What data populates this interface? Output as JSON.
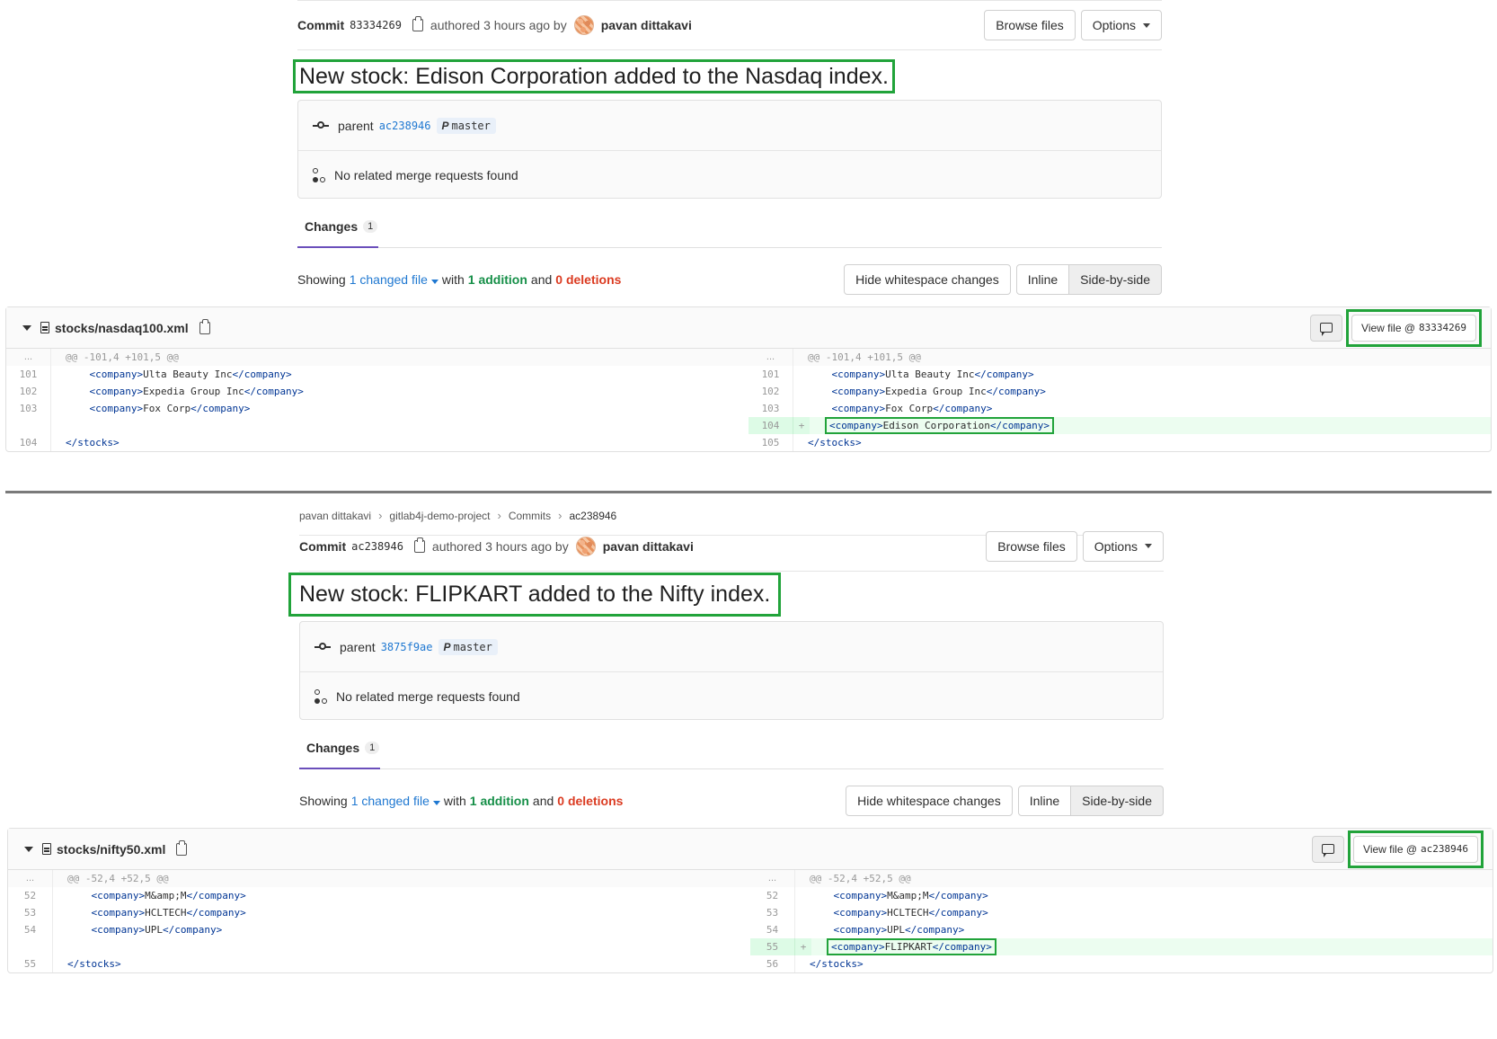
{
  "panel1": {
    "commit_label": "Commit",
    "commit_sha": "83334269",
    "authored_text": "authored 3 hours ago by",
    "author_name": "pavan dittakavi",
    "browse_files_label": "Browse files",
    "options_label": "Options",
    "title": "New stock: Edison Corporation added to the Nasdaq index.",
    "parent_label": "parent",
    "parent_sha": "ac238946",
    "branch": "master",
    "merge_text": "No related merge requests found",
    "tab_label": "Changes",
    "tab_count": "1",
    "stats": {
      "showing": "Showing",
      "changed_files": "1 changed file",
      "with": "with",
      "additions": "1 addition",
      "and": "and",
      "deletions": "0 deletions"
    },
    "hide_ws_label": "Hide whitespace changes",
    "inline_label": "Inline",
    "side_by_side_label": "Side-by-side",
    "file_path": "stocks/nasdaq100.xml",
    "view_file_label": "View file @",
    "view_file_sha": "83334269",
    "hunk": "@@ -101,4 +101,5 @@",
    "left": [
      {
        "ln": "...",
        "code": ""
      },
      {
        "ln": "101",
        "tag_open": "<company>",
        "text": "Ulta Beauty Inc",
        "tag_close": "</company>"
      },
      {
        "ln": "102",
        "tag_open": "<company>",
        "text": "Expedia Group Inc",
        "tag_close": "</company>"
      },
      {
        "ln": "103",
        "tag_open": "<company>",
        "text": "Fox Corp",
        "tag_close": "</company>"
      },
      {
        "ln": "104",
        "tag_open": "</stocks>",
        "text": "",
        "tag_close": ""
      }
    ],
    "right": [
      {
        "ln": "101",
        "tag_open": "<company>",
        "text": "Ulta Beauty Inc",
        "tag_close": "</company>"
      },
      {
        "ln": "102",
        "tag_open": "<company>",
        "text": "Expedia Group Inc",
        "tag_close": "</company>"
      },
      {
        "ln": "103",
        "tag_open": "<company>",
        "text": "Fox Corp",
        "tag_close": "</company>"
      },
      {
        "ln": "104",
        "marker": "+",
        "tag_open": "<company>",
        "text": "Edison Corporation",
        "tag_close": "</company>"
      },
      {
        "ln": "105",
        "tag_open": "</stocks>",
        "text": "",
        "tag_close": ""
      }
    ],
    "dots": "..."
  },
  "panel2": {
    "breadcrumb": [
      "pavan dittakavi",
      "gitlab4j-demo-project",
      "Commits",
      "ac238946"
    ],
    "commit_label": "Commit",
    "commit_sha": "ac238946",
    "authored_text": "authored 3 hours ago by",
    "author_name": "pavan dittakavi",
    "browse_files_label": "Browse files",
    "options_label": "Options",
    "title": "New stock: FLIPKART added to the Nifty index.",
    "parent_label": "parent",
    "parent_sha": "3875f9ae",
    "branch": "master",
    "merge_text": "No related merge requests found",
    "tab_label": "Changes",
    "tab_count": "1",
    "stats": {
      "showing": "Showing",
      "changed_files": "1 changed file",
      "with": "with",
      "additions": "1 addition",
      "and": "and",
      "deletions": "0 deletions"
    },
    "hide_ws_label": "Hide whitespace changes",
    "inline_label": "Inline",
    "side_by_side_label": "Side-by-side",
    "file_path": "stocks/nifty50.xml",
    "view_file_label": "View file @",
    "view_file_sha": "ac238946",
    "hunk": "@@ -52,4 +52,5 @@",
    "left": [
      {
        "ln": "52",
        "tag_open": "<company>",
        "text": "M&amp;M",
        "tag_close": "</company>"
      },
      {
        "ln": "53",
        "tag_open": "<company>",
        "text": "HCLTECH",
        "tag_close": "</company>"
      },
      {
        "ln": "54",
        "tag_open": "<company>",
        "text": "UPL",
        "tag_close": "</company>"
      },
      {
        "ln": "55",
        "tag_open": "</stocks>",
        "text": "",
        "tag_close": ""
      }
    ],
    "right": [
      {
        "ln": "52",
        "tag_open": "<company>",
        "text": "M&amp;M",
        "tag_close": "</company>"
      },
      {
        "ln": "53",
        "tag_open": "<company>",
        "text": "HCLTECH",
        "tag_close": "</company>"
      },
      {
        "ln": "54",
        "tag_open": "<company>",
        "text": "UPL",
        "tag_close": "</company>"
      },
      {
        "ln": "55",
        "marker": "+",
        "tag_open": "<company>",
        "text": "FLIPKART",
        "tag_close": "</company>"
      },
      {
        "ln": "56",
        "tag_open": "</stocks>",
        "text": "",
        "tag_close": ""
      }
    ],
    "dots": "..."
  },
  "colors": {
    "highlight": "#21a33a",
    "link": "#1f78d1",
    "addition": "#168f48",
    "deletion": "#db3b21",
    "tab_active": "#6b4fbb",
    "added_line_bg": "#ecfdf0"
  },
  "icons": [
    "copy-icon",
    "avatar",
    "commit-node-icon",
    "merge-request-icon",
    "branch-icon",
    "chevron-down-icon",
    "file-icon",
    "comment-icon"
  ]
}
